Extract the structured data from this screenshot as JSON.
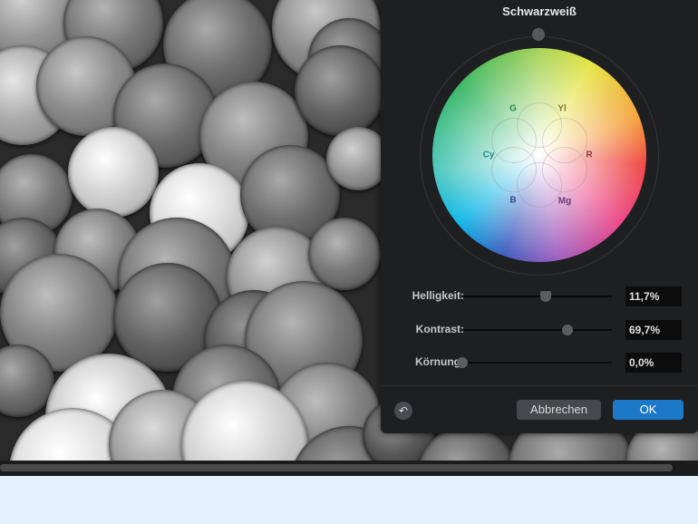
{
  "dialog": {
    "title": "Schwarzweiß",
    "wheel_labels": {
      "g": "G",
      "yl": "Yl",
      "cy": "Cy",
      "r": "R",
      "b": "B",
      "mg": "Mg"
    },
    "sliders": [
      {
        "label": "Helligkeit:",
        "value": "11,7%",
        "position": 0.555
      },
      {
        "label": "Kontrast:",
        "value": "69,7%",
        "position": 0.7
      },
      {
        "label": "Körnung:",
        "value": "0,0%",
        "position": 0.0
      }
    ],
    "reset_icon": "undo-arrow-icon",
    "cancel_label": "Abbrechen",
    "ok_label": "OK"
  },
  "colors": {
    "accent": "#1c78c8"
  }
}
